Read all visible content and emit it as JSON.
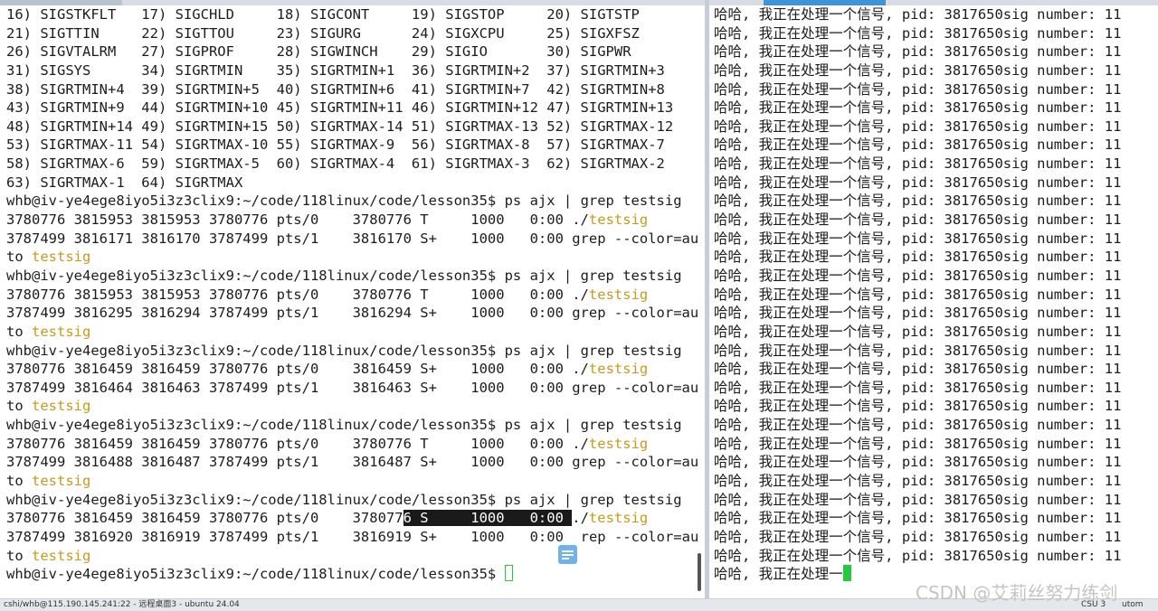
{
  "left_terminal": {
    "signal_list": [
      "16) SIGSTKFLT   17) SIGCHLD     18) SIGCONT     19) SIGSTOP     20) SIGTSTP",
      "21) SIGTTIN     22) SIGTTOU     23) SIGURG      24) SIGXCPU     25) SIGXFSZ",
      "26) SIGVTALRM   27) SIGPROF     28) SIGWINCH    29) SIGIO       30) SIGPWR",
      "31) SIGSYS      34) SIGRTMIN    35) SIGRTMIN+1  36) SIGRTMIN+2  37) SIGRTMIN+3",
      "38) SIGRTMIN+4  39) SIGRTMIN+5  40) SIGRTMIN+6  41) SIGRTMIN+7  42) SIGRTMIN+8",
      "43) SIGRTMIN+9  44) SIGRTMIN+10 45) SIGRTMIN+11 46) SIGRTMIN+12 47) SIGRTMIN+13",
      "48) SIGRTMIN+14 49) SIGRTMIN+15 50) SIGRTMAX-14 51) SIGRTMAX-13 52) SIGRTMAX-12",
      "53) SIGRTMAX-11 54) SIGRTMAX-10 55) SIGRTMAX-9  56) SIGRTMAX-8  57) SIGRTMAX-7",
      "58) SIGRTMAX-6  59) SIGRTMAX-5  60) SIGRTMAX-4  61) SIGRTMAX-3  62) SIGRTMAX-2",
      "63) SIGRTMAX-1  64) SIGRTMAX"
    ],
    "prompt": "whb@iv-ye4ege8iyo5i3z3clix9:~/code/118linux/code/lesson35$ ",
    "command": "ps ajx | grep testsig",
    "wrap_prefix": "to ",
    "keyword": "testsig",
    "blocks": [
      {
        "row1": "3780776 3815953 3815953 3780776 pts/0    3780776 T     1000   0:00 ./",
        "row2": "3787499 3816171 3816170 3787499 pts/1    3816170 S+    1000   0:00 grep --color=au"
      },
      {
        "row1": "3780776 3815953 3815953 3780776 pts/0    3780776 T     1000   0:00 ./",
        "row2": "3787499 3816295 3816294 3787499 pts/1    3816294 S+    1000   0:00 grep --color=au"
      },
      {
        "row1": "3780776 3816459 3816459 3780776 pts/0    3816459 S+    1000   0:00 ./",
        "row2": "3787499 3816464 3816463 3787499 pts/1    3816463 S+    1000   0:00 grep --color=au"
      },
      {
        "row1": "3780776 3816459 3816459 3780776 pts/0    3780776 T     1000   0:00 ./",
        "row2": "3787499 3816488 3816487 3787499 pts/1    3816487 S+    1000   0:00 grep --color=au"
      }
    ],
    "last_block": {
      "row1_before": "3780776 3816459 3816459 3780776 pts/0    378077",
      "row1_selected": "6 S     1000   0:00 ",
      "row1_after": "./",
      "row2_before": "3787499 3816920 3816919 3787499 pts/1    3816919 S+    1000   0:00 ",
      "row2_after": "rep --color=au"
    }
  },
  "right_terminal": {
    "message": "哈哈, 我正在处理一个信号, pid: 3817650sig number: 11",
    "partial_message": "哈哈, 我正在处理一",
    "repeat_count": 30
  },
  "status_bar": {
    "left_text": "cshi/whb@115.190.145.241:22 - 远程桌面3 - ubuntu 24.04",
    "right_text": "CSU 3",
    "right_text2": "utom"
  },
  "watermark": "CSDN @艾莉丝努力练剑",
  "colors": {
    "keyword": "#c79a1e",
    "cursor": "#27c93f",
    "selection_bg": "#1a1a1a",
    "active_tab": "#3f93d6"
  }
}
